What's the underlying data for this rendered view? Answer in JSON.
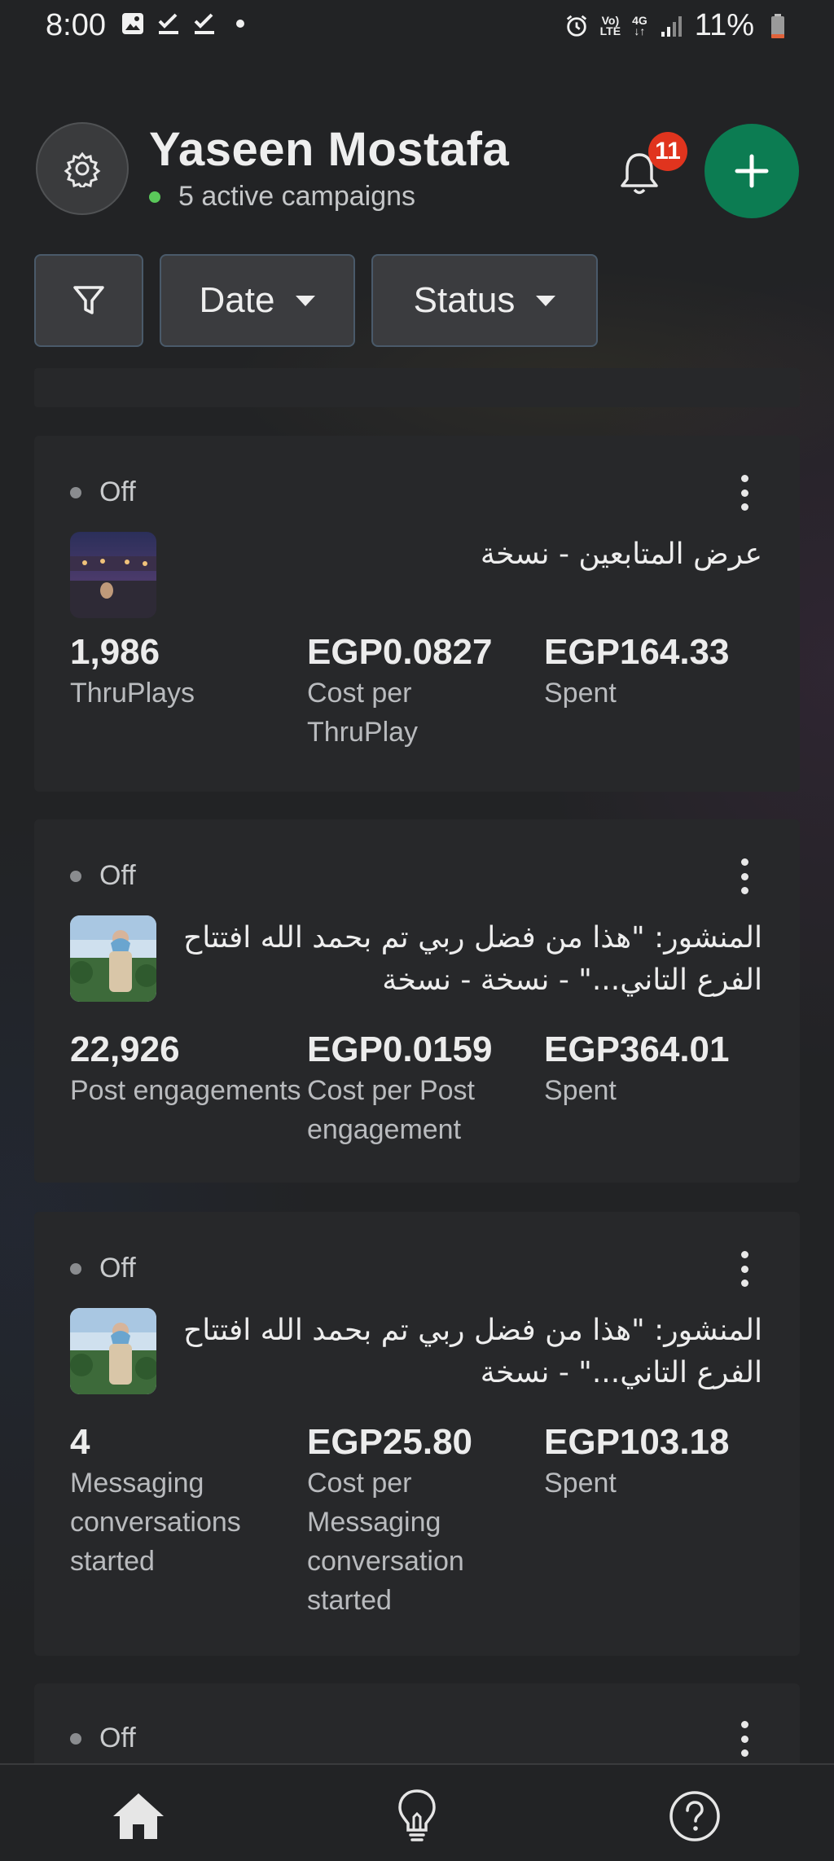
{
  "status_bar": {
    "time": "8:00",
    "battery": "11%",
    "icons": [
      "gallery-icon",
      "check-icon",
      "check-icon",
      "dot-icon",
      "alarm-icon",
      "volte-icon",
      "4g-icon",
      "signal-icon",
      "battery-icon"
    ],
    "volte_top": "Vo)",
    "volte_bottom": "LTE",
    "net_top": "4G",
    "net_bottom": "↓↑"
  },
  "header": {
    "name": "Yaseen Mostafa",
    "subtitle": "5 active campaigns",
    "notifications_count": "11",
    "accent_color": "#0c7c52"
  },
  "filters": {
    "date_label": "Date",
    "status_label": "Status"
  },
  "campaigns": [
    {
      "status": "Off",
      "title": "عرض المتابعين - نسخة",
      "metrics": [
        {
          "value": "1,986",
          "label": "ThruPlays"
        },
        {
          "value": "EGP0.0827",
          "label": "Cost per ThruPlay"
        },
        {
          "value": "EGP164.33",
          "label": "Spent"
        }
      ]
    },
    {
      "status": "Off",
      "title": "المنشور: \"هذا من فضل ربي تم بحمد الله افتتاح الفرع التاني...\" - نسخة - نسخة",
      "metrics": [
        {
          "value": "22,926",
          "label": "Post engagements"
        },
        {
          "value": "EGP0.0159",
          "label": "Cost per Post engagement"
        },
        {
          "value": "EGP364.01",
          "label": "Spent"
        }
      ]
    },
    {
      "status": "Off",
      "title": "المنشور: \"هذا من فضل ربي تم بحمد الله افتتاح الفرع التاني...\" - نسخة",
      "metrics": [
        {
          "value": "4",
          "label": "Messaging conversations started"
        },
        {
          "value": "EGP25.80",
          "label": "Cost per Messaging conversation started"
        },
        {
          "value": "EGP103.18",
          "label": "Spent"
        }
      ]
    },
    {
      "status": "Off"
    }
  ],
  "bottom_nav": [
    "home-icon",
    "lightbulb-icon",
    "help-icon"
  ]
}
